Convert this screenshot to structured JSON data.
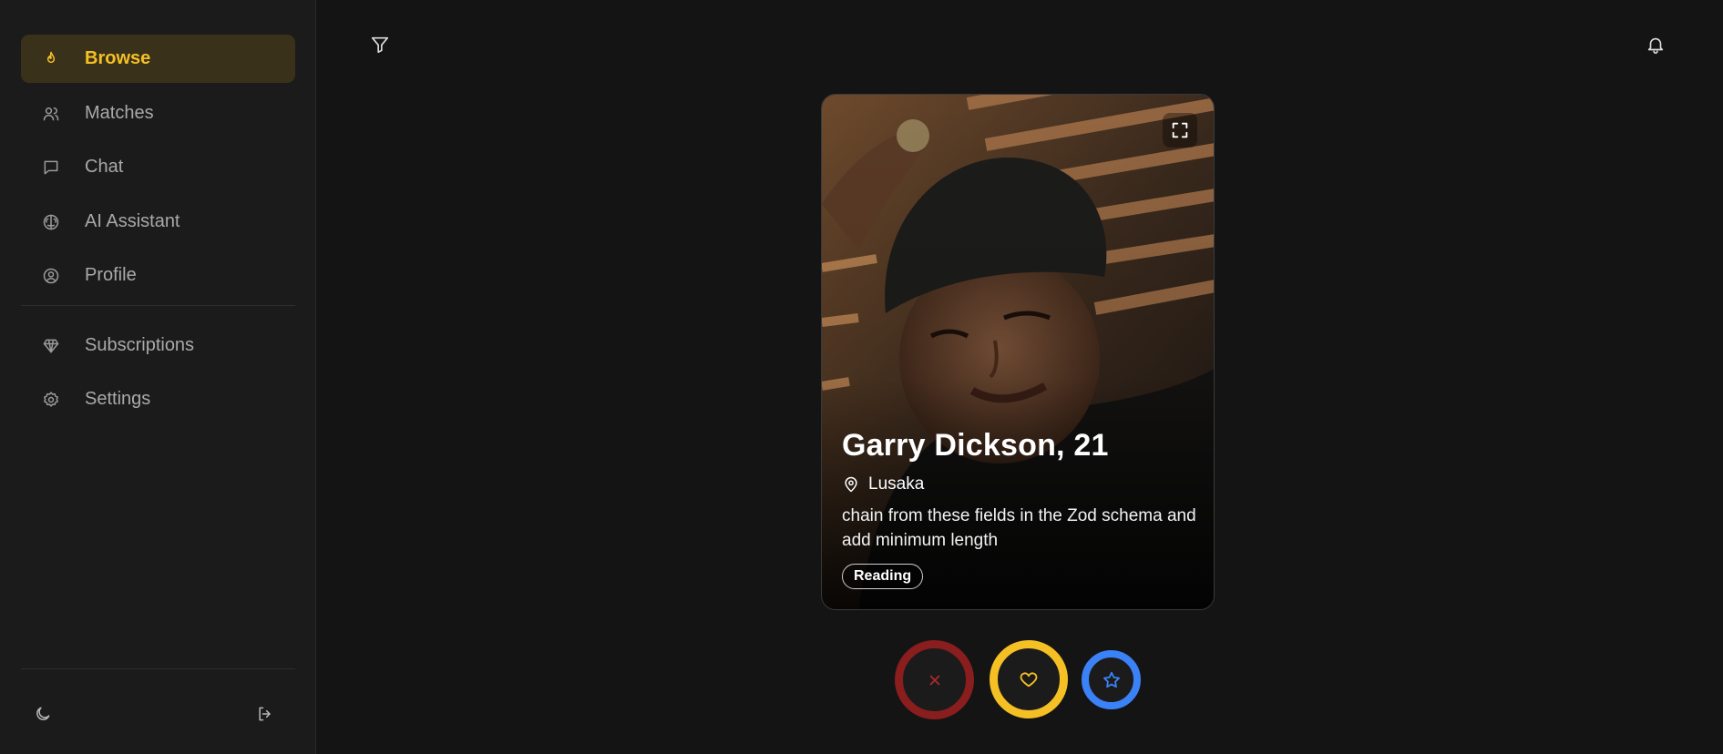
{
  "sidebar": {
    "items": [
      {
        "label": "Browse",
        "icon": "flame-icon",
        "active": true
      },
      {
        "label": "Matches",
        "icon": "users-icon"
      },
      {
        "label": "Chat",
        "icon": "chat-icon"
      },
      {
        "label": "AI Assistant",
        "icon": "brain-icon"
      },
      {
        "label": "Profile",
        "icon": "user-circle-icon"
      }
    ],
    "secondary": [
      {
        "label": "Subscriptions",
        "icon": "gem-icon"
      },
      {
        "label": "Settings",
        "icon": "gear-icon"
      }
    ],
    "bottom": {
      "theme_icon": "moon-icon",
      "logout_icon": "logout-icon"
    }
  },
  "topbar": {
    "filter_icon": "filter-icon",
    "notifications_icon": "bell-icon"
  },
  "profile_card": {
    "name_age": "Garry Dickson, 21",
    "location": "Lusaka",
    "bio": "chain from these fields in the Zod schema and add minimum length",
    "tags": [
      "Reading"
    ],
    "expand_icon": "expand-icon"
  },
  "actions": {
    "pass_icon": "x-icon",
    "like_icon": "heart-icon",
    "superlike_icon": "star-icon"
  },
  "colors": {
    "accent": "#f5c024",
    "pass": "#8a1d1d",
    "superlike": "#3b82f6",
    "sidebar_bg": "#1b1b1b",
    "page_bg": "#141414"
  }
}
